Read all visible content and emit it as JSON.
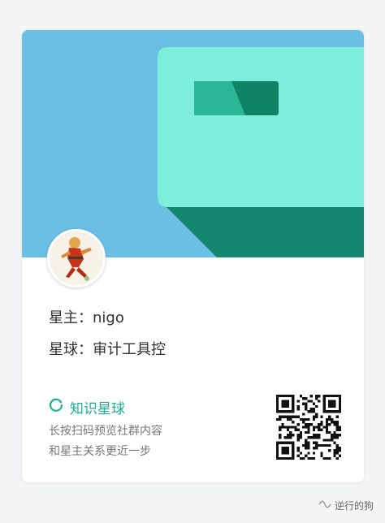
{
  "card": {
    "owner_line": "星主：nigo",
    "planet_line": "星球：审计工具控"
  },
  "brand": {
    "name": "知识星球",
    "icon": "knowledge-planet-ring-icon",
    "color": "#19b092"
  },
  "description": {
    "line1": "长按扫码预览社群内容",
    "line2": "和星主关系更近一步"
  },
  "watermark": {
    "text": "逆行的狗",
    "icon": "wechat-channel-icon"
  },
  "colors": {
    "banner_sky": "#6bbfe5",
    "box_light": "#7eeeda",
    "box_dark": "#14876e",
    "accent": "#19b092"
  }
}
